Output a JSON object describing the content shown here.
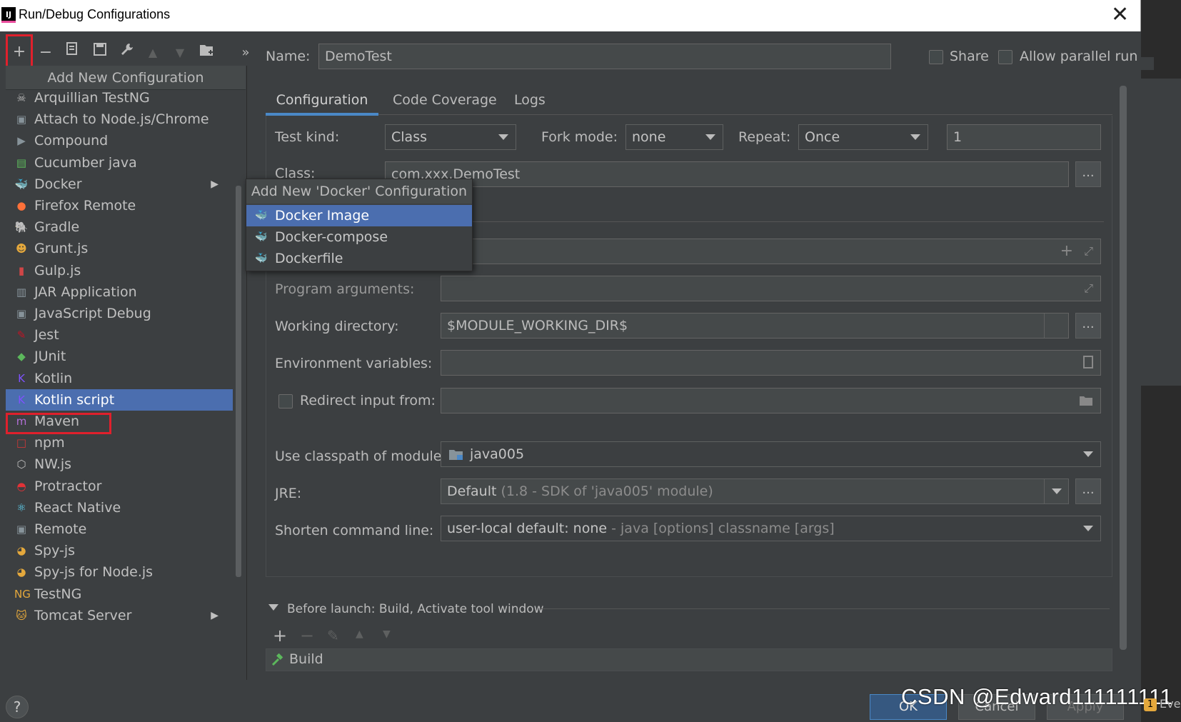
{
  "window": {
    "title": "Run/Debug Configurations",
    "close": "✕",
    "app_badge": "IJ"
  },
  "toolbar": {
    "add": "+",
    "remove": "−",
    "more": "»"
  },
  "left": {
    "header": "Add New Configuration",
    "items": [
      {
        "label": "Arquillian TestNG",
        "icon": "☠"
      },
      {
        "label": "Attach to Node.js/Chrome",
        "icon": "▣"
      },
      {
        "label": "Compound",
        "icon": "▶"
      },
      {
        "label": "Cucumber java",
        "icon": "▤"
      },
      {
        "label": "Docker",
        "icon": "🐳",
        "submenu": true
      },
      {
        "label": "Firefox Remote",
        "icon": "●"
      },
      {
        "label": "Gradle",
        "icon": "🐘"
      },
      {
        "label": "Grunt.js",
        "icon": "☻"
      },
      {
        "label": "Gulp.js",
        "icon": "▮"
      },
      {
        "label": "JAR Application",
        "icon": "▥"
      },
      {
        "label": "JavaScript Debug",
        "icon": "▣"
      },
      {
        "label": "Jest",
        "icon": "✎"
      },
      {
        "label": "JUnit",
        "icon": "◆"
      },
      {
        "label": "Kotlin",
        "icon": "K"
      },
      {
        "label": "Kotlin script",
        "icon": "K",
        "selected": true
      },
      {
        "label": "Maven",
        "icon": "m"
      },
      {
        "label": "npm",
        "icon": "□"
      },
      {
        "label": "NW.js",
        "icon": "⬡"
      },
      {
        "label": "Protractor",
        "icon": "◓"
      },
      {
        "label": "React Native",
        "icon": "⚛"
      },
      {
        "label": "Remote",
        "icon": "▣"
      },
      {
        "label": "Spy-js",
        "icon": "◕"
      },
      {
        "label": "Spy-js for Node.js",
        "icon": "◕"
      },
      {
        "label": "TestNG",
        "icon": "NG"
      },
      {
        "label": "Tomcat Server",
        "icon": "🐱",
        "submenu": true
      }
    ]
  },
  "popup": {
    "header": "Add New 'Docker' Configuration",
    "items": [
      {
        "label": "Docker Image",
        "selected": true
      },
      {
        "label": "Docker-compose"
      },
      {
        "label": "Dockerfile"
      }
    ]
  },
  "form": {
    "name_label": "Name:",
    "name_value": "DemoTest",
    "share_label": "Share",
    "parallel_label": "Allow parallel run",
    "tabs": [
      "Configuration",
      "Code Coverage",
      "Logs"
    ],
    "test_kind_label": "Test kind:",
    "test_kind_value": "Class",
    "fork_mode_label": "Fork mode:",
    "fork_mode_value": "none",
    "repeat_label": "Repeat:",
    "repeat_value": "Once",
    "repeat_count": "1",
    "class_label": "Class:",
    "class_value": "com.xxx.DemoTest",
    "program_args_label": "Program arguments:",
    "working_dir_label": "Working directory:",
    "working_dir_value": "$MODULE_WORKING_DIR$",
    "env_vars_label": "Environment variables:",
    "redirect_label": "Redirect input from:",
    "classpath_label": "Use classpath of module:",
    "classpath_value": "java005",
    "jre_label": "JRE:",
    "jre_value": "Default",
    "jre_hint": "(1.8 - SDK of 'java005' module)",
    "shorten_label": "Shorten command line:",
    "shorten_value": "user-local default: none",
    "shorten_hint": " - java [options] classname [args]",
    "ellipsis": "...",
    "before_launch": "Before launch: Build, Activate tool window",
    "build_item": "Build"
  },
  "bottom": {
    "help": "?",
    "ok": "OK",
    "cancel": "Cancel",
    "apply": "Apply",
    "watermark": "CSDN @Edward111111111",
    "badge": "1",
    "event": "Eve"
  },
  "colors": {
    "bg": "#3c3f41",
    "selection": "#4b6eaf",
    "highlight": "#e0202c",
    "tab_underline": "#4a88c7"
  }
}
